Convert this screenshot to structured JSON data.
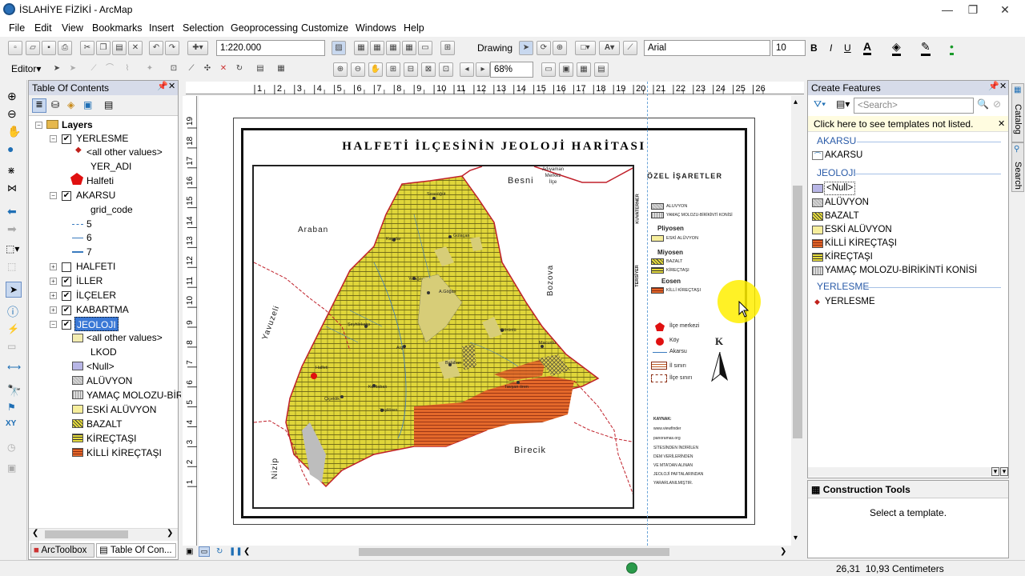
{
  "window": {
    "title": "İSLAHİYE FİZİKİ - ArcMap",
    "controls": [
      "—",
      "❐",
      "✕"
    ]
  },
  "menu": [
    "File",
    "Edit",
    "View",
    "Bookmarks",
    "Insert",
    "Selection",
    "Geoprocessing",
    "Customize",
    "Windows",
    "Help"
  ],
  "toolbar": {
    "scale": "1:220.000",
    "drawing_label": "Drawing",
    "font": "Arial",
    "font_size": "10",
    "bold": "B",
    "italic": "I",
    "underline": "U",
    "editor_label": "Editor",
    "zoom_pct": "68%"
  },
  "toc": {
    "title": "Table Of Contents",
    "layers_label": "Layers",
    "items": [
      {
        "label": "YERLESME"
      },
      {
        "label": "<all other values>"
      },
      {
        "label": "YER_ADI"
      },
      {
        "label": "Halfeti"
      },
      {
        "label": "AKARSU"
      },
      {
        "label": "grid_code"
      },
      {
        "label": "5"
      },
      {
        "label": "6"
      },
      {
        "label": "7"
      },
      {
        "label": "HALFETI"
      },
      {
        "label": "İLLER"
      },
      {
        "label": "İLÇELER"
      },
      {
        "label": "KABARTMA"
      },
      {
        "label": "JEOLOJI"
      },
      {
        "label": "<all other values>"
      },
      {
        "label": "LKOD"
      },
      {
        "label": "<Null>"
      },
      {
        "label": "ALÜVYON"
      },
      {
        "label": "YAMAÇ MOLOZU-BİRİ"
      },
      {
        "label": "ESKİ ALÜVYON"
      },
      {
        "label": "BAZALT"
      },
      {
        "label": "KİREÇTAŞI"
      },
      {
        "label": "KİLLİ KİREÇTAŞI"
      }
    ],
    "bottom_tabs": [
      "ArcToolbox",
      "Table Of Con..."
    ]
  },
  "ruler": {
    "top": [
      "1",
      "2",
      "3",
      "4",
      "5",
      "6",
      "7",
      "8",
      "9",
      "10",
      "11",
      "12",
      "13",
      "14",
      "15",
      "16",
      "17",
      "18",
      "19",
      "20",
      "21",
      "22",
      "23",
      "24",
      "25",
      "26"
    ],
    "left": [
      "19",
      "18",
      "17",
      "16",
      "15",
      "14",
      "13",
      "12",
      "11",
      "10",
      "9",
      "8",
      "7",
      "6",
      "5",
      "4",
      "3",
      "2",
      "1"
    ]
  },
  "map": {
    "title": "HALFETİ İLÇESİNİN JEOLOJİ HARİTASI",
    "places": {
      "besni": "Besni",
      "adiyaman": "Adıyaman\nMerkez\nİlçe",
      "araban": "Araban",
      "bozova": "Bozova",
      "yavuzeli": "Yavuzeli",
      "nizip": "Nizip",
      "birecik": "Birecik",
      "halfeti": "Halfeti"
    },
    "villages": [
      "Sırasöğüt",
      "Kayalar",
      "Gülaçan",
      "Yolağzı",
      "A.Göğüs",
      "Şeyhlekatçı",
      "Argil",
      "Görünlü",
      "Macunlu",
      "Balaban",
      "Tavşan ören",
      "Kurtlabak",
      "Çiçeklik",
      "Yeşilören",
      "Halfeti"
    ],
    "legend": {
      "title": "ÖZEL İŞARETLER",
      "kuvaterner": "KUVATERNER",
      "tersiyer": "TERSİYER",
      "aluvyon": "ALUVYON",
      "yamac": "YAMAÇ MOLOZU-BİRİKİNTİ KONİSİ",
      "pliyosen": "Pliyosen",
      "eski": "ESKİ ALÜVYON",
      "miyosen": "Miyosen",
      "bazalt": "BAZALT",
      "kirectasi": "KİREÇTAŞI",
      "eosen": "Eosen",
      "killi": "KİLLİ KİREÇTAŞI",
      "ilce_merkezi": "İlçe merkezi",
      "koy": "Köy",
      "akarsu": "Akarsu",
      "il_siniri": "İl sınırı",
      "ilce_siniri": "İlçe sınırı",
      "north": "K"
    },
    "source": [
      "KAYNAK:",
      "www.viewfinder",
      "panoramas.org",
      "SİTESİNDEN İNDİRİLEN",
      "DEM VERİLERİNDEN",
      "VE MTA'DAN ALINAN",
      "JEOLOJİ PAFTALARINDAN",
      "YARARLANILMIŞTIR."
    ]
  },
  "create_features": {
    "title": "Create Features",
    "search_placeholder": "<Search>",
    "notice": "Click here to see templates not listed.",
    "groups": [
      {
        "name": "AKARSU",
        "items": [
          "AKARSU"
        ]
      },
      {
        "name": "JEOLOJI",
        "items": [
          "<Null>",
          "ALÜVYON",
          "BAZALT",
          "ESKİ ALÜVYON",
          "KİLLİ KİREÇTAŞI",
          "KİREÇTAŞI",
          "YAMAÇ MOLOZU-BİRİKİNTİ KONİSİ"
        ]
      },
      {
        "name": "YERLESME",
        "items": [
          "YERLESME"
        ]
      }
    ],
    "construction_title": "Construction Tools",
    "construction_msg": "Select a template."
  },
  "side_tabs": [
    "Catalog",
    "Search"
  ],
  "status": {
    "coords": "26,31  10,93 Centimeters"
  },
  "colors": {
    "yellow": "#e6dc3c",
    "olive": "#c8c23a",
    "orange": "#e4682a",
    "panel_head": "#d6dbe9",
    "highlight": "#3a78d6"
  }
}
